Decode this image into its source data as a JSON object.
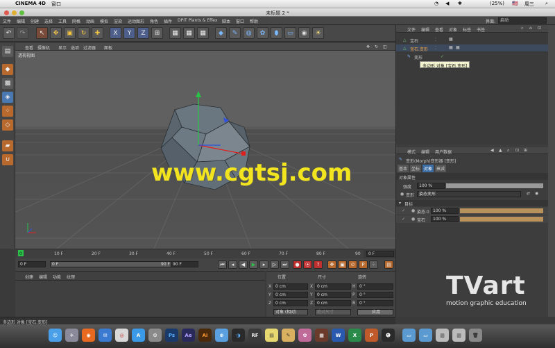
{
  "os_menubar": {
    "app_name": "CINEMA 4D",
    "menu_window": "窗口",
    "battery": "(25%)",
    "clock": "周三",
    "input": "🇺🇸"
  },
  "window": {
    "title": "未标题 2 *"
  },
  "menubar": {
    "items": [
      "文件",
      "编辑",
      "创建",
      "选择",
      "工具",
      "网格",
      "动画",
      "模拟",
      "渲染",
      "运动图形",
      "角色",
      "插件",
      "DPIT Plants & Effex",
      "脚本",
      "窗口",
      "帮助"
    ],
    "layout_label": "界面:",
    "layout_value": "启动"
  },
  "viewport": {
    "menu": [
      "查看",
      "摄像机",
      "显示",
      "选项",
      "过滤器",
      "面板"
    ],
    "label": "透视视图"
  },
  "watermark": {
    "site": "www.cgtsj.com",
    "brand": "TVart",
    "tagline": "motion graphic education"
  },
  "timeline": {
    "ticks": [
      "0",
      "10 F",
      "20 F",
      "30 F",
      "40 F",
      "50 F",
      "60 F",
      "70 F",
      "80 F",
      "90"
    ],
    "current_frame": "0 F"
  },
  "playbar": {
    "start": "0 F",
    "range_start": "0 F",
    "range_end": "90 F",
    "end": "90 F"
  },
  "material_panel": {
    "menu": [
      "创建",
      "编辑",
      "功能",
      "纹理"
    ]
  },
  "coord_panel": {
    "headers": [
      "位置",
      "尺寸",
      "旋转"
    ],
    "rows": [
      {
        "axis": "X",
        "pos": "0 cm",
        "size_axis": "X",
        "size": "0 cm",
        "rot_axis": "H",
        "rot": "0 °"
      },
      {
        "axis": "Y",
        "pos": "0 cm",
        "size_axis": "Y",
        "size": "0 cm",
        "rot_axis": "P",
        "rot": "0 °"
      },
      {
        "axis": "Z",
        "pos": "0 cm",
        "size_axis": "Z",
        "size": "0 cm",
        "rot_axis": "B",
        "rot": "0 °"
      }
    ],
    "mode": "对象 (相对)",
    "size_mode": "绝对尺寸",
    "apply": "应用"
  },
  "status": {
    "text": "多边形 对象 [宝石.变形]"
  },
  "objects": {
    "menu": [
      "文件",
      "编辑",
      "查看",
      "对象",
      "标签",
      "书签"
    ],
    "items": [
      "宝石",
      "宝石.变形",
      "变形"
    ],
    "tooltip": "多边形 对象 [宝石.变形]"
  },
  "attributes": {
    "menu": [
      "模式",
      "编辑",
      "用户数据"
    ],
    "title": "变形(Morph)变形器 [变形]",
    "tabs": [
      "基本",
      "坐标",
      "对象",
      "衰减"
    ],
    "section": "对象属性",
    "strength_label": "强度",
    "strength_value": "100 %",
    "morph_label": "变形",
    "morph_value": "姿态变形",
    "group": "目标",
    "targets": [
      {
        "name": "姿态.0",
        "value": "100 %"
      },
      {
        "name": "宝石",
        "value": "100 %"
      }
    ]
  },
  "dock": {
    "apps": [
      "Finder",
      "Launchpad",
      "Firefox",
      "Mail",
      "Chrome",
      "App Store",
      "Preferences",
      "Ps",
      "AE",
      "Ai",
      "Safari",
      "C4D",
      "RF",
      "Stickies",
      "Notes",
      "Photos",
      "Word",
      "Excel",
      "PowerPoint",
      "QQ",
      "Trash"
    ]
  },
  "colors": {
    "accent": "#e0622b",
    "selection": "#3d6ea5",
    "watermark": "#f2e51f",
    "axis_x": "#e02020",
    "axis_y": "#2bc24a",
    "axis_z": "#3050e0"
  }
}
